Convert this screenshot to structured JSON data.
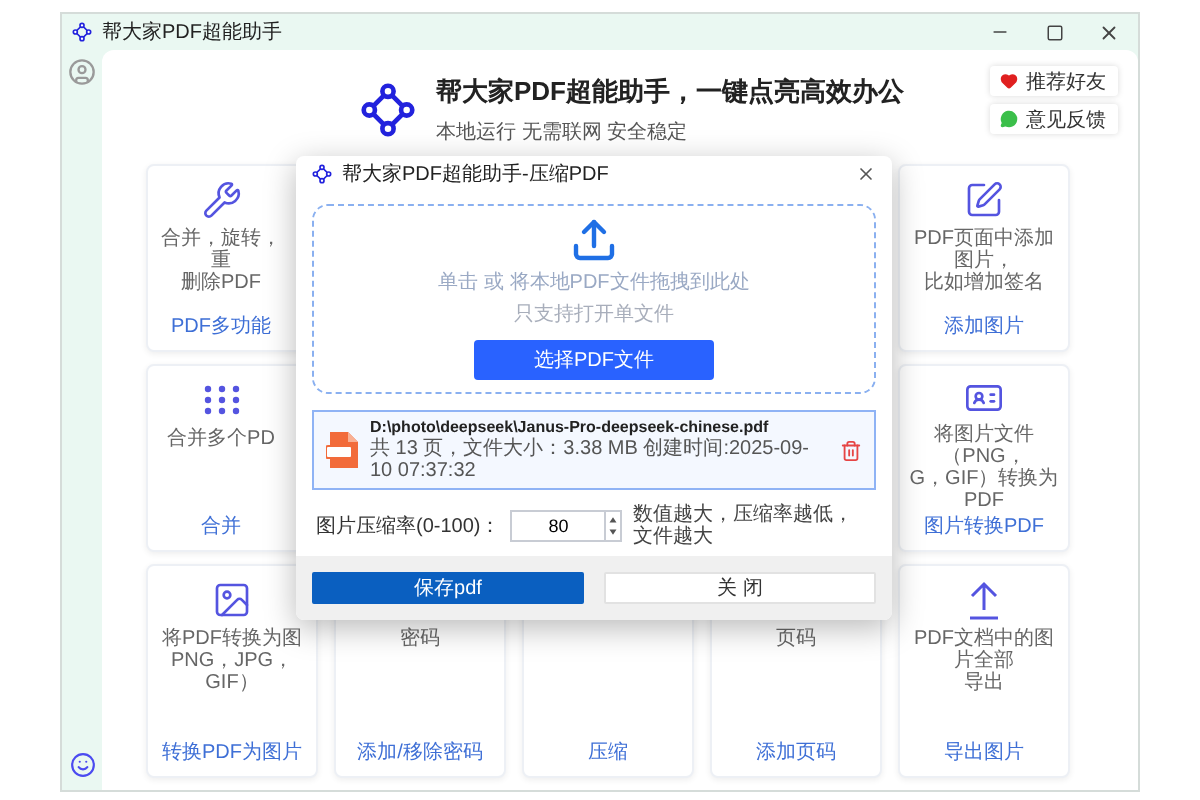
{
  "window": {
    "title": "帮大家PDF超能助手"
  },
  "header": {
    "title": "帮大家PDF超能助手，一键点亮高效办公",
    "subtitle": "本地运行 无需联网 安全稳定"
  },
  "side_buttons": [
    {
      "label": "推荐好友"
    },
    {
      "label": "意见反馈"
    }
  ],
  "tool_rows": [
    {
      "cards": [
        {
          "desc": [
            "合并，旋转，重",
            "删除PDF"
          ],
          "label": "PDF多功能"
        },
        {
          "desc": [
            "PDF页面中添加图片，",
            "比如增加签名"
          ],
          "label": "添加图片"
        }
      ]
    },
    {
      "cards": [
        {
          "desc": [
            "合并多个PD"
          ],
          "label": "合并"
        },
        {
          "desc": [
            "将图片文件（PNG，",
            "G，GIF）转换为PDF"
          ],
          "label": "图片转换PDF"
        }
      ]
    },
    {
      "cards": [
        {
          "desc": [
            "将PDF转换为图",
            "PNG，JPG，GIF）"
          ],
          "label": "转换PDF为图片"
        },
        {
          "desc": [
            "密码"
          ],
          "label": "添加/移除密码"
        },
        {
          "label": "压缩"
        },
        {
          "desc": [
            "页码"
          ],
          "label": "添加页码"
        },
        {
          "desc": [
            "PDF文档中的图片全部",
            "导出"
          ],
          "label": "导出图片"
        }
      ]
    }
  ],
  "dialog": {
    "title": "帮大家PDF超能助手-压缩PDF",
    "drop_zone": {
      "hint": "单击 或 将本地PDF文件拖拽到此处",
      "note": "只支持打开单文件",
      "button": "选择PDF文件"
    },
    "file": {
      "path": "D:\\photo\\deepseek\\Janus-Pro-deepseek-chinese.pdf",
      "info": "共 13 页，文件大小：3.38 MB 创建时间:2025-09-10 07:37:32"
    },
    "compression": {
      "label": "图片压缩率(0-100)：",
      "value": "80",
      "hint": "数值越大，压缩率越低，文件越大"
    },
    "buttons": [
      {
        "label": "保存pdf",
        "primary": true
      },
      {
        "label": "关 闭",
        "primary": false
      }
    ]
  }
}
